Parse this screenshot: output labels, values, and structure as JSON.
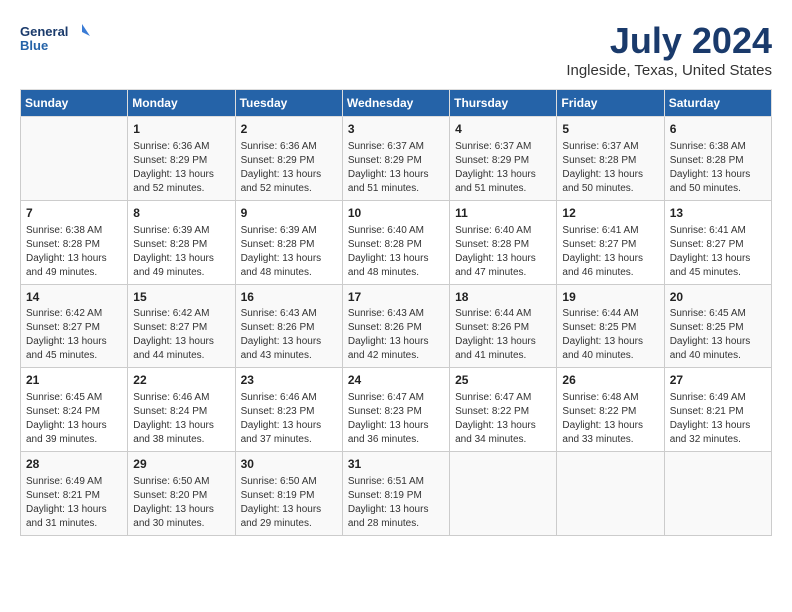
{
  "header": {
    "logo_line1": "General",
    "logo_line2": "Blue",
    "month": "July 2024",
    "location": "Ingleside, Texas, United States"
  },
  "days_of_week": [
    "Sunday",
    "Monday",
    "Tuesday",
    "Wednesday",
    "Thursday",
    "Friday",
    "Saturday"
  ],
  "weeks": [
    [
      {
        "day": "",
        "info": ""
      },
      {
        "day": "1",
        "info": "Sunrise: 6:36 AM\nSunset: 8:29 PM\nDaylight: 13 hours\nand 52 minutes."
      },
      {
        "day": "2",
        "info": "Sunrise: 6:36 AM\nSunset: 8:29 PM\nDaylight: 13 hours\nand 52 minutes."
      },
      {
        "day": "3",
        "info": "Sunrise: 6:37 AM\nSunset: 8:29 PM\nDaylight: 13 hours\nand 51 minutes."
      },
      {
        "day": "4",
        "info": "Sunrise: 6:37 AM\nSunset: 8:29 PM\nDaylight: 13 hours\nand 51 minutes."
      },
      {
        "day": "5",
        "info": "Sunrise: 6:37 AM\nSunset: 8:28 PM\nDaylight: 13 hours\nand 50 minutes."
      },
      {
        "day": "6",
        "info": "Sunrise: 6:38 AM\nSunset: 8:28 PM\nDaylight: 13 hours\nand 50 minutes."
      }
    ],
    [
      {
        "day": "7",
        "info": "Sunrise: 6:38 AM\nSunset: 8:28 PM\nDaylight: 13 hours\nand 49 minutes."
      },
      {
        "day": "8",
        "info": "Sunrise: 6:39 AM\nSunset: 8:28 PM\nDaylight: 13 hours\nand 49 minutes."
      },
      {
        "day": "9",
        "info": "Sunrise: 6:39 AM\nSunset: 8:28 PM\nDaylight: 13 hours\nand 48 minutes."
      },
      {
        "day": "10",
        "info": "Sunrise: 6:40 AM\nSunset: 8:28 PM\nDaylight: 13 hours\nand 48 minutes."
      },
      {
        "day": "11",
        "info": "Sunrise: 6:40 AM\nSunset: 8:28 PM\nDaylight: 13 hours\nand 47 minutes."
      },
      {
        "day": "12",
        "info": "Sunrise: 6:41 AM\nSunset: 8:27 PM\nDaylight: 13 hours\nand 46 minutes."
      },
      {
        "day": "13",
        "info": "Sunrise: 6:41 AM\nSunset: 8:27 PM\nDaylight: 13 hours\nand 45 minutes."
      }
    ],
    [
      {
        "day": "14",
        "info": "Sunrise: 6:42 AM\nSunset: 8:27 PM\nDaylight: 13 hours\nand 45 minutes."
      },
      {
        "day": "15",
        "info": "Sunrise: 6:42 AM\nSunset: 8:27 PM\nDaylight: 13 hours\nand 44 minutes."
      },
      {
        "day": "16",
        "info": "Sunrise: 6:43 AM\nSunset: 8:26 PM\nDaylight: 13 hours\nand 43 minutes."
      },
      {
        "day": "17",
        "info": "Sunrise: 6:43 AM\nSunset: 8:26 PM\nDaylight: 13 hours\nand 42 minutes."
      },
      {
        "day": "18",
        "info": "Sunrise: 6:44 AM\nSunset: 8:26 PM\nDaylight: 13 hours\nand 41 minutes."
      },
      {
        "day": "19",
        "info": "Sunrise: 6:44 AM\nSunset: 8:25 PM\nDaylight: 13 hours\nand 40 minutes."
      },
      {
        "day": "20",
        "info": "Sunrise: 6:45 AM\nSunset: 8:25 PM\nDaylight: 13 hours\nand 40 minutes."
      }
    ],
    [
      {
        "day": "21",
        "info": "Sunrise: 6:45 AM\nSunset: 8:24 PM\nDaylight: 13 hours\nand 39 minutes."
      },
      {
        "day": "22",
        "info": "Sunrise: 6:46 AM\nSunset: 8:24 PM\nDaylight: 13 hours\nand 38 minutes."
      },
      {
        "day": "23",
        "info": "Sunrise: 6:46 AM\nSunset: 8:23 PM\nDaylight: 13 hours\nand 37 minutes."
      },
      {
        "day": "24",
        "info": "Sunrise: 6:47 AM\nSunset: 8:23 PM\nDaylight: 13 hours\nand 36 minutes."
      },
      {
        "day": "25",
        "info": "Sunrise: 6:47 AM\nSunset: 8:22 PM\nDaylight: 13 hours\nand 34 minutes."
      },
      {
        "day": "26",
        "info": "Sunrise: 6:48 AM\nSunset: 8:22 PM\nDaylight: 13 hours\nand 33 minutes."
      },
      {
        "day": "27",
        "info": "Sunrise: 6:49 AM\nSunset: 8:21 PM\nDaylight: 13 hours\nand 32 minutes."
      }
    ],
    [
      {
        "day": "28",
        "info": "Sunrise: 6:49 AM\nSunset: 8:21 PM\nDaylight: 13 hours\nand 31 minutes."
      },
      {
        "day": "29",
        "info": "Sunrise: 6:50 AM\nSunset: 8:20 PM\nDaylight: 13 hours\nand 30 minutes."
      },
      {
        "day": "30",
        "info": "Sunrise: 6:50 AM\nSunset: 8:19 PM\nDaylight: 13 hours\nand 29 minutes."
      },
      {
        "day": "31",
        "info": "Sunrise: 6:51 AM\nSunset: 8:19 PM\nDaylight: 13 hours\nand 28 minutes."
      },
      {
        "day": "",
        "info": ""
      },
      {
        "day": "",
        "info": ""
      },
      {
        "day": "",
        "info": ""
      }
    ]
  ]
}
